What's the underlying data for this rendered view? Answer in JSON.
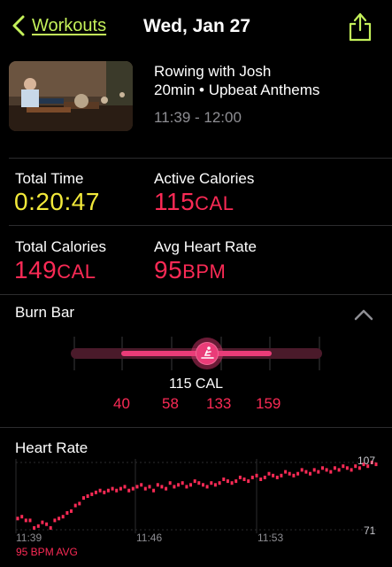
{
  "header": {
    "back_label": "Workouts",
    "title": "Wed, Jan 27"
  },
  "workout": {
    "name": "Rowing with Josh",
    "subtitle": "20min • Upbeat Anthems",
    "time_range": "11:39 - 12:00"
  },
  "metrics": {
    "total_time": {
      "label": "Total Time",
      "value": "0:20:47"
    },
    "active_calories": {
      "label": "Active Calories",
      "value": "115",
      "unit": "CAL"
    },
    "total_calories": {
      "label": "Total Calories",
      "value": "149",
      "unit": "CAL"
    },
    "avg_heart_rate": {
      "label": "Avg Heart Rate",
      "value": "95",
      "unit": "BPM"
    }
  },
  "burn_bar": {
    "title": "Burn Bar",
    "current_label": "115 CAL",
    "ticks": [
      "40",
      "58",
      "133",
      "159"
    ]
  },
  "heart_rate": {
    "title": "Heart Rate",
    "x_labels": [
      "11:39",
      "11:46",
      "11:53"
    ],
    "avg_label": "95 BPM AVG",
    "y_max": "107",
    "y_min": "71"
  },
  "colors": {
    "accent_green": "#c4f05a",
    "yellow": "#f2e93a",
    "red": "#fa2a55",
    "burn_pink": "#ea3c78"
  },
  "chart_data": {
    "type": "line",
    "title": "Heart Rate",
    "xlabel": "",
    "ylabel": "",
    "ylim": [
      71,
      107
    ],
    "x_tick_labels": [
      "11:39",
      "11:46",
      "11:53"
    ],
    "series": [
      {
        "values": [
          77,
          78,
          76,
          76,
          72,
          73,
          75,
          74,
          72,
          76,
          77,
          78,
          80,
          81,
          84,
          85,
          88,
          89,
          90,
          91,
          92,
          91,
          92,
          93,
          92,
          93,
          94,
          92,
          93,
          94,
          95,
          93,
          94,
          92,
          95,
          94,
          93,
          96,
          94,
          95,
          96,
          94,
          95,
          97,
          96,
          95,
          94,
          96,
          95,
          96,
          98,
          97,
          96,
          97,
          99,
          98,
          97,
          99,
          100,
          98,
          99,
          101,
          100,
          99,
          100,
          102,
          101,
          100,
          101,
          103,
          102,
          101,
          103,
          102,
          104,
          103,
          102,
          104,
          103,
          105,
          104,
          103,
          105,
          104,
          106,
          105,
          107,
          106
        ]
      }
    ]
  }
}
